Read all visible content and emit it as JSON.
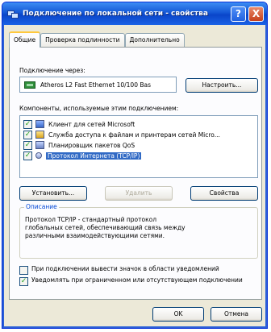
{
  "window": {
    "title": "Подключение по локальной сети - свойства",
    "help_label": "?",
    "close_label": "X"
  },
  "tabs": [
    {
      "label": "Общие",
      "active": true
    },
    {
      "label": "Проверка подлинности",
      "active": false
    },
    {
      "label": "Дополнительно",
      "active": false
    }
  ],
  "connect_using": {
    "label": "Подключение через:",
    "adapter": "Atheros L2 Fast Ethernet 10/100 Bas",
    "configure_label": "Настроить..."
  },
  "components": {
    "label": "Компоненты, используемые этим подключением:",
    "items": [
      {
        "label": "Клиент для сетей Microsoft",
        "checked": true,
        "selected": false,
        "icon": "network-client-icon"
      },
      {
        "label": "Служба доступа к файлам и принтерам сетей Micro...",
        "checked": true,
        "selected": false,
        "icon": "file-share-icon"
      },
      {
        "label": "Планировщик пакетов QoS",
        "checked": true,
        "selected": false,
        "icon": "qos-icon"
      },
      {
        "label": "Протокол Интернета (TCP/IP)",
        "checked": true,
        "selected": true,
        "icon": "protocol-icon"
      }
    ]
  },
  "buttons": {
    "install": "Установить...",
    "remove": "Удалить",
    "properties": "Свойства",
    "ok": "OK",
    "cancel": "Отмена"
  },
  "description": {
    "title": "Описание",
    "text": "Протокол TCP/IP - стандартный протокол глобальных сетей, обеспечивающий связь между различными взаимодействующими сетями."
  },
  "options": [
    {
      "label": "При подключении вывести значок в области уведомлений",
      "checked": false
    },
    {
      "label": "Уведомлять при ограниченном или отсутствующем подключении",
      "checked": true
    }
  ]
}
